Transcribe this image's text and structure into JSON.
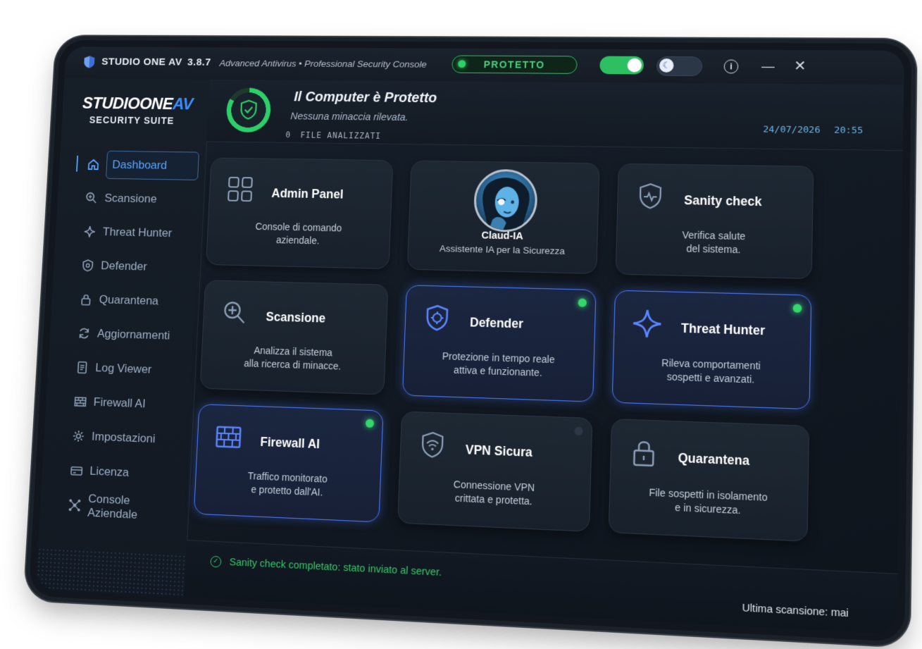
{
  "titlebar": {
    "app_name": "STUDIO ONE AV",
    "version": "3.8.7",
    "subtitle": "Advanced Antivirus  •  Professional Security Console",
    "status": "PROTETTO",
    "info": "i",
    "minimize": "—",
    "close": "✕",
    "moon": "☾"
  },
  "sidebar": {
    "logo_main": "STUDIOONE",
    "logo_av": "AV",
    "logo_sub": "SECURITY SUITE",
    "items": [
      {
        "label": "Dashboard",
        "icon": "home-icon"
      },
      {
        "label": "Scansione",
        "icon": "search-icon"
      },
      {
        "label": "Threat Hunter",
        "icon": "sparkle-icon"
      },
      {
        "label": "Defender",
        "icon": "shield-icon"
      },
      {
        "label": "Quarantena",
        "icon": "lock-icon"
      },
      {
        "label": "Aggiornamenti",
        "icon": "refresh-icon"
      },
      {
        "label": "Log Viewer",
        "icon": "document-icon"
      },
      {
        "label": "Firewall AI",
        "icon": "firewall-icon"
      },
      {
        "label": "Impostazioni",
        "icon": "gear-icon"
      },
      {
        "label": "Licenza",
        "icon": "card-icon"
      },
      {
        "label": "Console Aziendale",
        "icon": "network-icon"
      }
    ]
  },
  "header": {
    "title": "Il Computer è Protetto",
    "subtitle": "Nessuna minaccia rilevata.",
    "files_count": "0",
    "files_label": "FILE ANALIZZATI",
    "date": "24/07/2026",
    "time": "20:55"
  },
  "cards": {
    "admin": {
      "title": "Admin Panel",
      "desc1": "Console di comando",
      "desc2": "aziendale."
    },
    "ai": {
      "name": "Claud-IA",
      "desc": "Assistente IA per la Sicurezza"
    },
    "sanity": {
      "title": "Sanity check",
      "desc1": "Verifica salute",
      "desc2": "del sistema."
    },
    "scan": {
      "title": "Scansione",
      "desc1": "Analizza il sistema",
      "desc2": "alla ricerca di minacce."
    },
    "defender": {
      "title": "Defender",
      "desc1": "Protezione in tempo reale",
      "desc2": "attiva e funzionante."
    },
    "hunter": {
      "title": "Threat Hunter",
      "desc1": "Rileva comportamenti",
      "desc2": "sospetti e avanzati."
    },
    "firewall": {
      "title": "Firewall AI",
      "desc1": "Traffico monitorato",
      "desc2": "e protetto dall'AI."
    },
    "vpn": {
      "title": "VPN Sicura",
      "desc1": "Connessione VPN",
      "desc2": "crittata e protetta."
    },
    "quarantine": {
      "title": "Quarantena",
      "desc1": "File sospetti in isolamento",
      "desc2": "e in sicurezza."
    }
  },
  "footer": {
    "message": "Sanity check completato: stato inviato al server.",
    "last_scan": "Ultima scansione: mai"
  },
  "colors": {
    "accent": "#4d7bff",
    "success": "#34c96a",
    "background": "#12171f"
  }
}
